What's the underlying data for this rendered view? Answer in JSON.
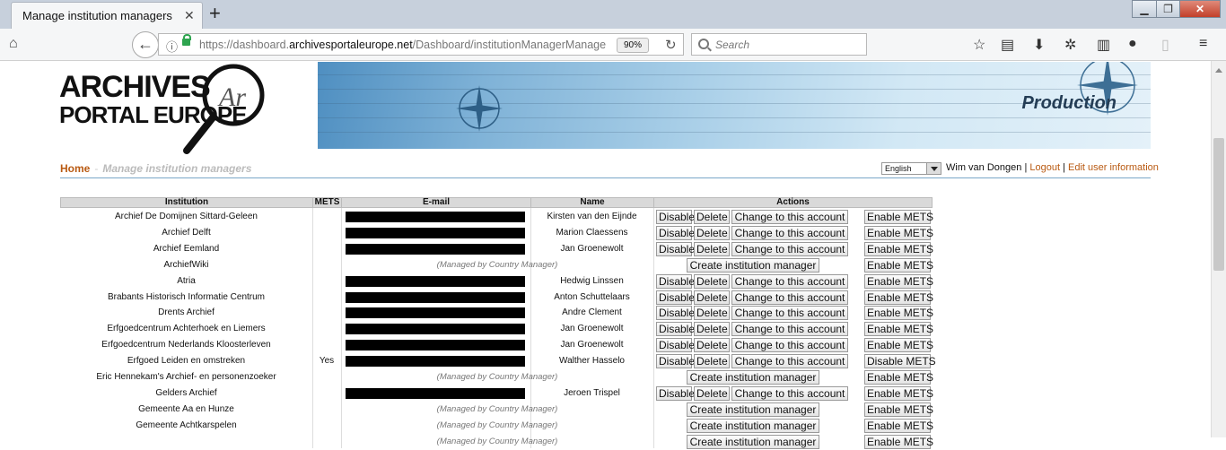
{
  "browser": {
    "tab_title": "Manage institution managers",
    "tab_close": "✕",
    "new_tab": "+",
    "url_host_prefix": "https://dashboard.",
    "url_host": "archivesportaleurope.net",
    "url_path": "/Dashboard/institutionManagerManage",
    "zoom": "90%",
    "search_placeholder": "Search",
    "window_buttons": [
      "▁",
      "❐",
      "✕"
    ]
  },
  "header": {
    "logo_line1": "ARCHIVES",
    "logo_line2": "PORTAL EUROPE",
    "logo_mark": "Ar",
    "banner_title": "Production"
  },
  "breadcrumb": {
    "home": "Home",
    "separator": "-",
    "current": "Manage institution managers"
  },
  "user": {
    "language": "English",
    "name": "Wim van Dongen",
    "sep": "|",
    "logout": "Logout",
    "edit": "Edit user information"
  },
  "table": {
    "columns": [
      "Institution",
      "METS",
      "E-mail",
      "Name",
      "Actions"
    ],
    "managed_text": "(Managed by Country Manager)",
    "labels": {
      "disable": "Disable",
      "delete": "Delete",
      "change": "Change to this account",
      "create": "Create institution manager",
      "enable_mets": "Enable METS",
      "disable_mets": "Disable METS"
    },
    "rows": [
      {
        "institution": "Archief De Domijnen Sittard-Geleen",
        "mets": "",
        "name": "Kirsten van den Eijnde",
        "managed": false
      },
      {
        "institution": "Archief Delft",
        "mets": "",
        "name": "Marion Claessens",
        "managed": false
      },
      {
        "institution": "Archief Eemland",
        "mets": "",
        "name": "Jan Groenewolt",
        "managed": false
      },
      {
        "institution": "ArchiefWiki",
        "mets": "",
        "name": "",
        "managed": true
      },
      {
        "institution": "Atria",
        "mets": "",
        "name": "Hedwig Linssen",
        "managed": false
      },
      {
        "institution": "Brabants Historisch Informatie Centrum",
        "mets": "",
        "name": "Anton Schuttelaars",
        "managed": false
      },
      {
        "institution": "Drents Archief",
        "mets": "",
        "name": "Andre Clement",
        "managed": false
      },
      {
        "institution": "Erfgoedcentrum Achterhoek en Liemers",
        "mets": "",
        "name": "Jan Groenewolt",
        "managed": false
      },
      {
        "institution": "Erfgoedcentrum Nederlands Kloosterleven",
        "mets": "",
        "name": "Jan Groenewolt",
        "managed": false
      },
      {
        "institution": "Erfgoed Leiden en omstreken",
        "mets": "Yes",
        "name": "Walther Hasselo",
        "managed": false
      },
      {
        "institution": "Eric Hennekam's Archief- en personenzoeker",
        "mets": "",
        "name": "",
        "managed": true
      },
      {
        "institution": "Gelders Archief",
        "mets": "",
        "name": "Jeroen Trispel",
        "managed": false
      },
      {
        "institution": "Gemeente Aa en Hunze",
        "mets": "",
        "name": "",
        "managed": true
      },
      {
        "institution": "Gemeente Achtkarspelen",
        "mets": "",
        "name": "",
        "managed": true
      },
      {
        "institution": "",
        "mets": "",
        "name": "",
        "managed": true
      }
    ]
  }
}
